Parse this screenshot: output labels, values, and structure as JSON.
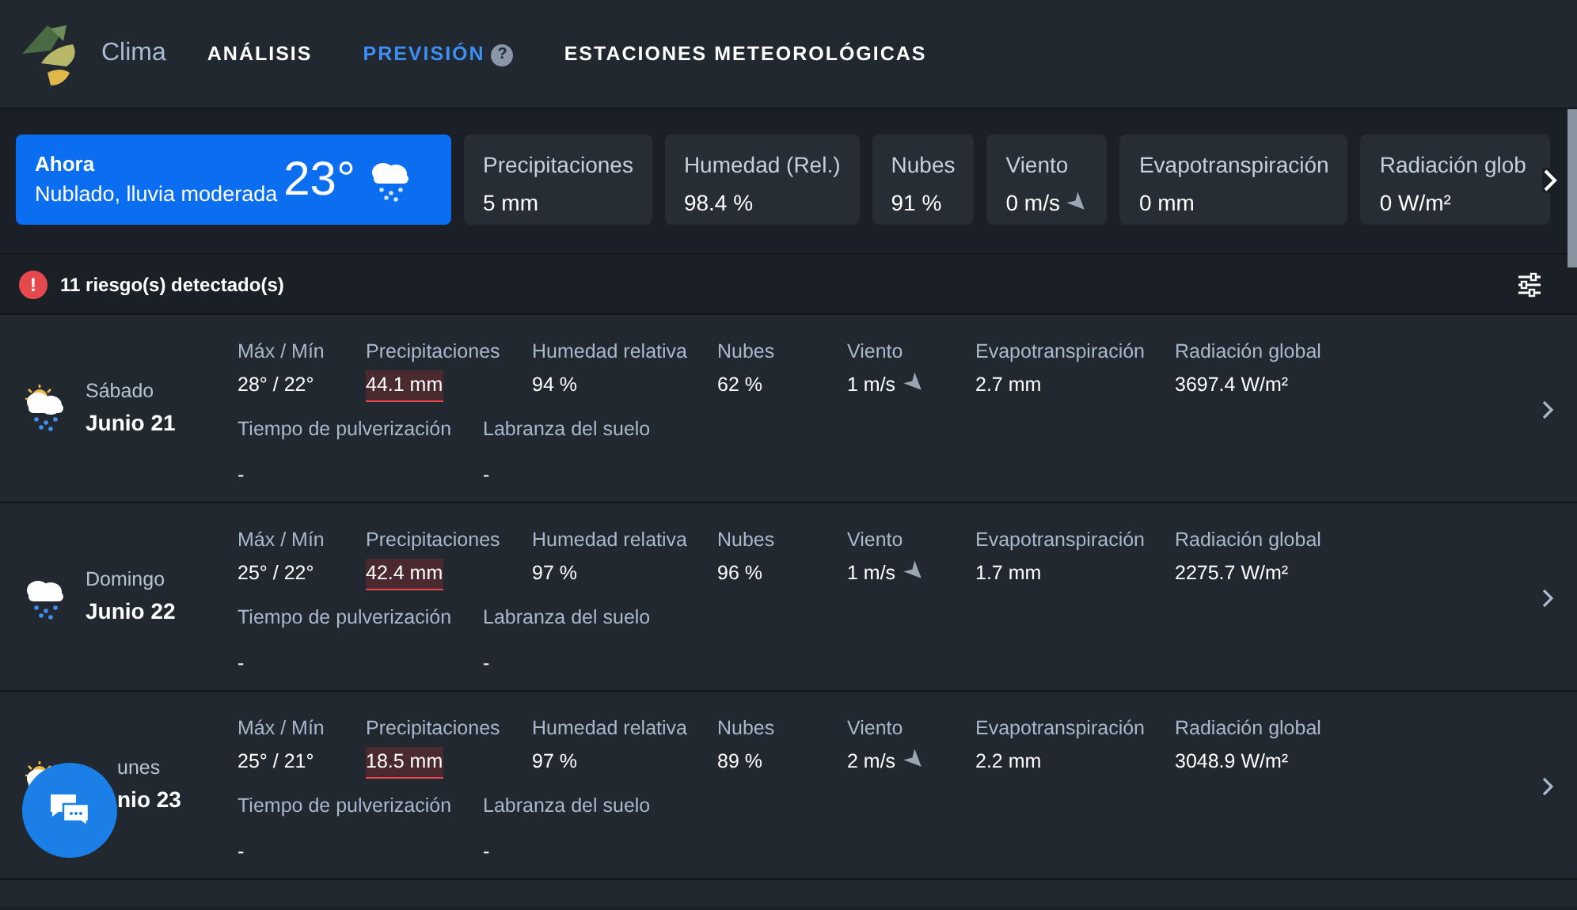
{
  "brand": "Clima",
  "nav": [
    {
      "label": "ANÁLISIS",
      "selected": false
    },
    {
      "label": "PREVISIÓN",
      "selected": true,
      "help_icon": "?"
    },
    {
      "label": "ESTACIONES METEOROLÓGICAS",
      "selected": false
    }
  ],
  "now": {
    "title": "Ahora",
    "condition": "Nublado, lluvia moderada",
    "temperature": "23°"
  },
  "now_metrics": [
    {
      "label": "Precipitaciones",
      "value": "5 mm",
      "kind": "plain"
    },
    {
      "label": "Humedad (Rel.)",
      "value": "98.4 %",
      "kind": "plain"
    },
    {
      "label": "Nubes",
      "value": "91 %",
      "kind": "plain"
    },
    {
      "label": "Viento",
      "value": "0 m/s",
      "kind": "wind"
    },
    {
      "label": "Evapotranspiración",
      "value": "0 mm",
      "kind": "plain"
    },
    {
      "label": "Radiación glob",
      "value": "0 W/m²",
      "kind": "plain"
    }
  ],
  "risks": {
    "icon": "!",
    "text": "11 riesgo(s) detectado(s)"
  },
  "days": [
    {
      "day": "Sábado",
      "date": "Junio 21",
      "kind": "showers",
      "metrics": [
        {
          "label": "Máx / Mín",
          "value": "28° / 22°"
        },
        {
          "label": "Precipitaciones",
          "value": "44.1 mm",
          "alert": true
        },
        {
          "label": "Humedad relativa",
          "value": "94 %"
        },
        {
          "label": "Nubes",
          "value": "62 %"
        },
        {
          "label": "Viento",
          "value": "1 m/s",
          "kind": "wind"
        },
        {
          "label": "Evapotranspiración",
          "value": "2.7 mm"
        },
        {
          "label": "Radiación global",
          "value": "3697.4 W/m²"
        }
      ],
      "extra": [
        {
          "label": "Tiempo de pulverización",
          "value": "-"
        },
        {
          "label": "Labranza del suelo",
          "value": "-"
        }
      ]
    },
    {
      "day": "Domingo",
      "date": "Junio 22",
      "kind": "rain",
      "metrics": [
        {
          "label": "Máx / Mín",
          "value": "25° / 22°"
        },
        {
          "label": "Precipitaciones",
          "value": "42.4 mm",
          "alert": true
        },
        {
          "label": "Humedad relativa",
          "value": "97 %"
        },
        {
          "label": "Nubes",
          "value": "96 %"
        },
        {
          "label": "Viento",
          "value": "1 m/s",
          "kind": "wind"
        },
        {
          "label": "Evapotranspiración",
          "value": "1.7 mm"
        },
        {
          "label": "Radiación global",
          "value": "2275.7 W/m²"
        }
      ],
      "extra": [
        {
          "label": "Tiempo de pulverización",
          "value": "-"
        },
        {
          "label": "Labranza del suelo",
          "value": "-"
        }
      ]
    },
    {
      "day": "unes",
      "date": "nio 23",
      "kind": "showers",
      "metrics": [
        {
          "label": "Máx / Mín",
          "value": "25° / 21°"
        },
        {
          "label": "Precipitaciones",
          "value": "18.5 mm",
          "alert": true
        },
        {
          "label": "Humedad relativa",
          "value": "97 %"
        },
        {
          "label": "Nubes",
          "value": "89 %"
        },
        {
          "label": "Viento",
          "value": "2 m/s",
          "kind": "wind"
        },
        {
          "label": "Evapotranspiración",
          "value": "2.2 mm"
        },
        {
          "label": "Radiación global",
          "value": "3048.9 W/m²"
        }
      ],
      "extra": [
        {
          "label": "Tiempo de pulverización",
          "value": "-"
        },
        {
          "label": "Labranza del suelo",
          "value": "-"
        }
      ]
    }
  ]
}
